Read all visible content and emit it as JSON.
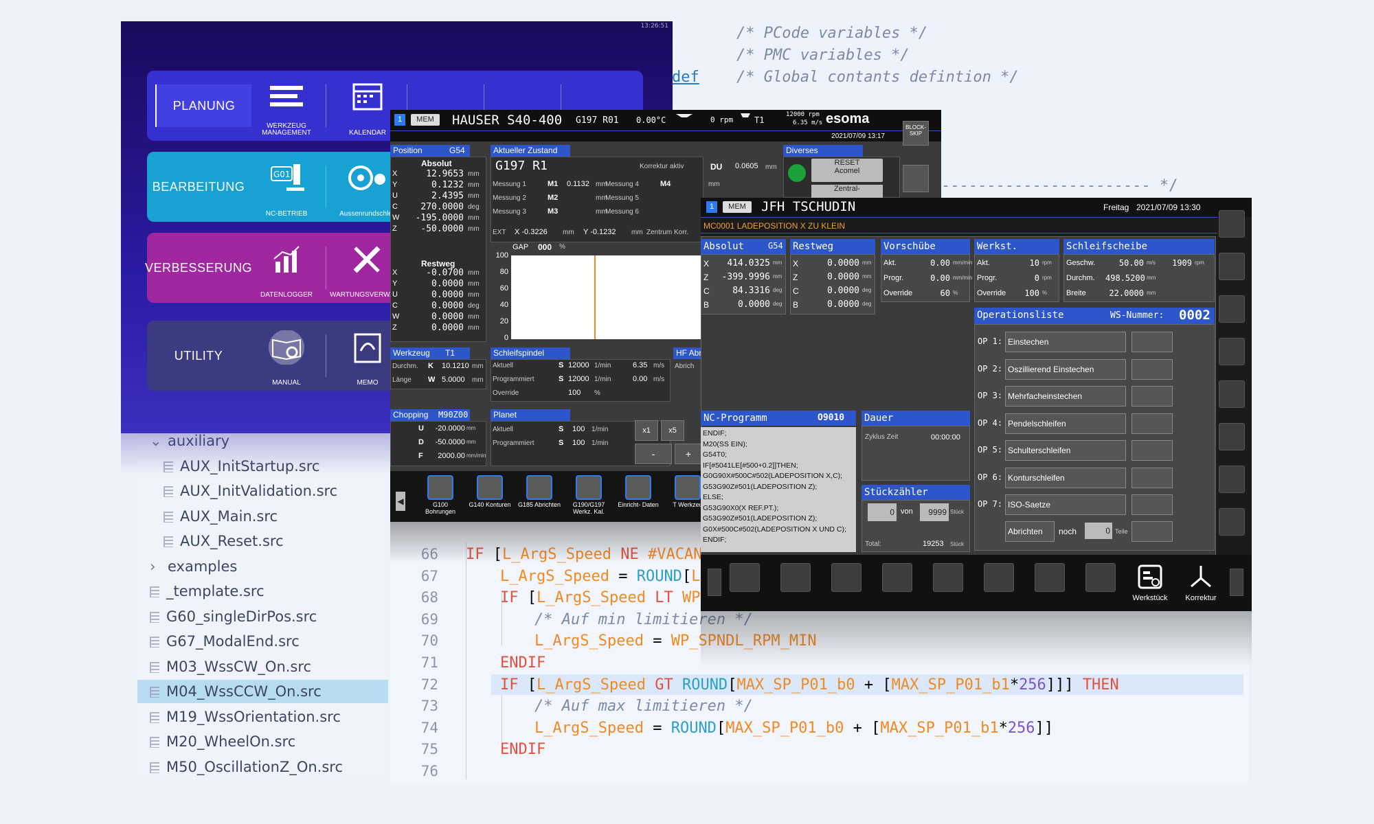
{
  "code_top": {
    "lines": [
      "/* PCode variables */",
      "/* PMC variables */",
      "/* Global contants defintion */"
    ],
    "def_keyword": "def",
    "divider": "----------------------- */"
  },
  "code_bottom": {
    "lines": [
      {
        "num": "66",
        "text": "IF [L_ArgS_Speed NE #VACANT"
      },
      {
        "num": "67",
        "text": "L_ArgS_Speed = ROUND[L_"
      },
      {
        "num": "68",
        "text": "IF [L_ArgS_Speed LT WP_"
      },
      {
        "num": "69",
        "text": "/* Auf min limitieren */"
      },
      {
        "num": "70",
        "text": "L_ArgS_Speed = WP_SPNDL_RPM_MIN"
      },
      {
        "num": "71",
        "text": "ENDIF"
      },
      {
        "num": "72",
        "text": "IF [L_ArgS_Speed GT ROUND[MAX_SP_P01_b0 + [MAX_SP_P01_b1*256]]] THEN"
      },
      {
        "num": "73",
        "text": "/* Auf max limitieren */"
      },
      {
        "num": "74",
        "text": "L_ArgS_Speed = ROUND[MAX_SP_P01_b0 + [MAX_SP_P01_b1*256]]"
      },
      {
        "num": "75",
        "text": "ENDIF"
      },
      {
        "num": "76",
        "text": ""
      }
    ]
  },
  "file_tree": {
    "items": [
      {
        "label": "auxiliary",
        "type": "folder-open",
        "indent": 0
      },
      {
        "label": "AUX_InitStartup.src",
        "type": "file",
        "indent": 1
      },
      {
        "label": "AUX_InitValidation.src",
        "type": "file",
        "indent": 1
      },
      {
        "label": "AUX_Main.src",
        "type": "file",
        "indent": 1
      },
      {
        "label": "AUX_Reset.src",
        "type": "file",
        "indent": 1
      },
      {
        "label": "examples",
        "type": "folder",
        "indent": 0
      },
      {
        "label": "_template.src",
        "type": "file",
        "indent": 0
      },
      {
        "label": "G60_singleDirPos.src",
        "type": "file",
        "indent": 0
      },
      {
        "label": "G67_ModalEnd.src",
        "type": "file",
        "indent": 0
      },
      {
        "label": "M03_WssCW_On.src",
        "type": "file",
        "indent": 0
      },
      {
        "label": "M04_WssCCW_On.src",
        "type": "file-selected",
        "indent": 0
      },
      {
        "label": "M19_WssOrientation.src",
        "type": "file",
        "indent": 0
      },
      {
        "label": "M20_WheelOn.src",
        "type": "file",
        "indent": 0
      },
      {
        "label": "M50_OscillationZ_On.src",
        "type": "file",
        "indent": 0
      }
    ],
    "selected_color": "#b9dcf5"
  },
  "launcher": {
    "clock": "13:26:51",
    "rows": [
      {
        "label": "PLANUNG",
        "color": "#3a34d6",
        "tiles": [
          "WERKZEUG MANAGEMENT",
          "KALENDAR"
        ]
      },
      {
        "label": "BEARBEITUNG",
        "color": "#1aa6d6",
        "tiles": [
          "NC-BETRIEB",
          "Aussenrundschleif"
        ]
      },
      {
        "label": "VERBESSERUNG",
        "color": "#a02aa6",
        "tiles": [
          "DATENLOGGER",
          "WARTUNGSVERWALTUNG"
        ]
      },
      {
        "label": "UTILITY",
        "color": "#3d3d86",
        "tiles": [
          "MANUAL",
          "MEMO"
        ]
      }
    ]
  },
  "hauser": {
    "header": {
      "channel": "1",
      "mode": "MEM",
      "machine": "HAUSER S40-400",
      "gcode": "G197 R01",
      "temp": "0.00°C",
      "rpm": "0 rpm",
      "tool": "T1",
      "spindle_rpm": "12000 rpm",
      "spindle_speed": "6.35 m/s",
      "brand": "esoma",
      "datetime": "2021/07/09 13:17",
      "block_skip": "BLOCK-SKIP"
    },
    "position": {
      "title": "Position",
      "wcs": "G54",
      "absolute_label": "Absolut",
      "rows": [
        {
          "axis": "X",
          "value": "12.9653",
          "unit": "mm"
        },
        {
          "axis": "Y",
          "value": "0.1232",
          "unit": "mm"
        },
        {
          "axis": "U",
          "value": "2.4395",
          "unit": "mm"
        },
        {
          "axis": "C",
          "value": "270.0000",
          "unit": "deg"
        },
        {
          "axis": "W",
          "value": "-195.0000",
          "unit": "mm"
        },
        {
          "axis": "Z",
          "value": "-50.0000",
          "unit": "mm"
        }
      ],
      "restweg_label": "Restweg",
      "restweg": [
        {
          "axis": "X",
          "value": "-0.0700",
          "unit": "mm"
        },
        {
          "axis": "Y",
          "value": "0.0000",
          "unit": "mm"
        },
        {
          "axis": "U",
          "value": "0.0000",
          "unit": "mm"
        },
        {
          "axis": "C",
          "value": "0.0000",
          "unit": "deg"
        },
        {
          "axis": "W",
          "value": "0.0000",
          "unit": "mm"
        },
        {
          "axis": "Z",
          "value": "0.0000",
          "unit": "mm"
        }
      ]
    },
    "zustand": {
      "title": "Aktueller Zustand",
      "state": "G197 R1",
      "korrektur_label": "Korrektur aktiv",
      "du_label": "DU",
      "du_value": "0.0605",
      "du_unit": "mm",
      "mess": [
        {
          "label": "Messung 1",
          "code": "M1",
          "value": "0.1132",
          "unit": "mm"
        },
        {
          "label": "Messung 2",
          "code": "M2",
          "value": "",
          "unit": "mm"
        },
        {
          "label": "Messung 3",
          "code": "M3",
          "value": "",
          "unit": "mm"
        },
        {
          "label": "Messung 4",
          "code": "M4",
          "value": "",
          "unit": "mm"
        },
        {
          "label": "Messung 5",
          "code": "",
          "value": "",
          "unit": ""
        },
        {
          "label": "Messung 6",
          "code": "",
          "value": "",
          "unit": ""
        }
      ],
      "ext_label": "EXT",
      "ext_x": "X -0.3226",
      "ext_x_unit": "mm",
      "ext_y": "Y -0.1232",
      "ext_y_unit": "mm",
      "zentrum": "Zentrum Korr."
    },
    "gap": {
      "label": "GAP",
      "value": "000",
      "unit": "%",
      "ticks": [
        "100",
        "80",
        "60",
        "40",
        "20",
        "0"
      ],
      "marker_fraction": 0.44
    },
    "diverses": {
      "title": "Diverses",
      "reset": "RESET",
      "acomel": "Acomel",
      "zentral": "Zentral-"
    },
    "werkzeug": {
      "title": "Werkzeug",
      "tool": "T1",
      "durchm_label": "Durchm.",
      "durchm_code": "K",
      "durchm_value": "10.1210",
      "durchm_unit": "mm",
      "laenge_label": "Länge",
      "laenge_code": "W",
      "laenge_value": "5.0000",
      "laenge_unit": "mm"
    },
    "schleifspindel": {
      "title": "Schleifspindel",
      "rows": [
        {
          "label": "Aktuell",
          "code": "S",
          "value": "12000",
          "unit": "1/min",
          "v2": "6.35",
          "u2": "m/s"
        },
        {
          "label": "Programmiert",
          "code": "S",
          "value": "12000",
          "unit": "1/min",
          "v2": "0.00",
          "u2": "m/s"
        },
        {
          "label": "Override",
          "code": "",
          "value": "100",
          "unit": "%",
          "v2": "",
          "u2": ""
        }
      ]
    },
    "hf": {
      "title": "HF Abr",
      "sub": "Abrich"
    },
    "chopping": {
      "title": "Chopping",
      "code": "M90Z00",
      "rows": [
        {
          "code": "U",
          "value": "-20.0000",
          "unit": "mm"
        },
        {
          "code": "D",
          "value": "-50.0000",
          "unit": "mm"
        },
        {
          "code": "F",
          "value": "2000.00",
          "unit": "mm/min"
        }
      ]
    },
    "planet": {
      "title": "Planet",
      "rows": [
        {
          "label": "Aktuell",
          "code": "S",
          "value": "100",
          "unit": "1/min"
        },
        {
          "label": "Programmiert",
          "code": "S",
          "value": "100",
          "unit": "1/min"
        }
      ],
      "buttons": [
        "x1",
        "x5",
        "-",
        "+"
      ]
    },
    "softkeys": [
      {
        "label": "G100 Bohrungen"
      },
      {
        "label": "G140 Konturen"
      },
      {
        "label": "G185 Abrichten"
      },
      {
        "label": "G190/G197 Werkz. Kal."
      },
      {
        "label": "Einricht- Daten"
      },
      {
        "label": "T Werkzeu"
      }
    ]
  },
  "jfh": {
    "header": {
      "channel": "1",
      "mode": "MEM",
      "machine": "JFH TSCHUDIN",
      "day": "Freitag",
      "datetime": "2021/07/09 13:30"
    },
    "alarm": "MC0001 LADEPOSITION X ZU KLEIN",
    "absolut": {
      "title": "Absolut",
      "wcs": "G54",
      "rows": [
        {
          "axis": "X",
          "value": "414.0325",
          "unit": "mm"
        },
        {
          "axis": "Z",
          "value": "-399.9996",
          "unit": "mm"
        },
        {
          "axis": "C",
          "value": "84.3316",
          "unit": "deg"
        },
        {
          "axis": "B",
          "value": "0.0000",
          "unit": "deg"
        }
      ]
    },
    "restweg": {
      "title": "Restweg",
      "rows": [
        {
          "axis": "X",
          "value": "0.0000",
          "unit": "mm"
        },
        {
          "axis": "Z",
          "value": "0.0000",
          "unit": "mm"
        },
        {
          "axis": "C",
          "value": "0.0000",
          "unit": "deg"
        },
        {
          "axis": "B",
          "value": "0.0000",
          "unit": "deg"
        }
      ]
    },
    "vorschuebe": {
      "title": "Vorschübe",
      "rows": [
        {
          "label": "Akt.",
          "value": "0.00",
          "unit": "mm/min"
        },
        {
          "label": "Progr.",
          "value": "0.00",
          "unit": "mm/min"
        },
        {
          "label": "Override",
          "value": "60",
          "unit": "%"
        }
      ]
    },
    "spindel": {
      "title": "Werkst. Spindel",
      "rows": [
        {
          "label": "Akt.",
          "value": "10",
          "unit": "rpm"
        },
        {
          "label": "Progr.",
          "value": "0",
          "unit": "rpm"
        },
        {
          "label": "Override",
          "value": "100",
          "unit": "%"
        }
      ]
    },
    "schleifscheibe": {
      "title": "Schleifscheibe",
      "rows": [
        {
          "label": "Geschw.",
          "value": "50.00",
          "unit": "m/s",
          "extra": "1909",
          "extra_unit": "rpm"
        },
        {
          "label": "Durchm.",
          "value": "498.5200",
          "unit": "mm",
          "extra": "",
          "extra_unit": ""
        },
        {
          "label": "Breite",
          "value": "22.0000",
          "unit": "mm",
          "extra": "",
          "extra_unit": ""
        }
      ]
    },
    "oplist": {
      "title": "Operationsliste",
      "ws_label": "WS-Nummer:",
      "ws_value": "0002",
      "ops": [
        {
          "id": "OP 1:",
          "name": "Einstechen"
        },
        {
          "id": "OP 2:",
          "name": "Oszillierend Einstechen"
        },
        {
          "id": "OP 3:",
          "name": "Mehrfacheinstechen"
        },
        {
          "id": "OP 4:",
          "name": "Pendelschleifen"
        },
        {
          "id": "OP 5:",
          "name": "Schulterschleifen"
        },
        {
          "id": "OP 6:",
          "name": "Konturschleifen"
        },
        {
          "id": "OP 7:",
          "name": "ISO-Saetze"
        }
      ],
      "abrichten": "Abrichten",
      "noch": "noch",
      "noch_value": "0",
      "teile": "Teile"
    },
    "nc": {
      "title": "NC-Programm",
      "number": "O9010",
      "lines": [
        "ENDIF;",
        "M20(SS EIN);",
        "G54T0;",
        "IF[#5041LE[#500+0.2]]THEN;",
        "G0G90X#500C#502(LADEPOSITION X,C);",
        "G53G90Z#501(LADEPOSITION Z);",
        "ELSE;",
        "G53G90X0(X REF.PT.);",
        "G53G90Z#501(LADEPOSITION Z);",
        "G0X#500C#502(LADEPOSITION X UND C);",
        "ENDIF;"
      ]
    },
    "dauer": {
      "title": "Dauer",
      "zyklus_label": "Zyklus Zeit",
      "zyklus_value": "00:00:00"
    },
    "stueck": {
      "title": "Stückzähler",
      "count": "0",
      "von": "von",
      "target": "9999",
      "unit": "Stück",
      "total_label": "Total:",
      "total_value": "19253",
      "total_unit": "Stück"
    },
    "softkeys": {
      "werkstueck": "Werkstück",
      "korrektur": "Korrektur"
    }
  }
}
